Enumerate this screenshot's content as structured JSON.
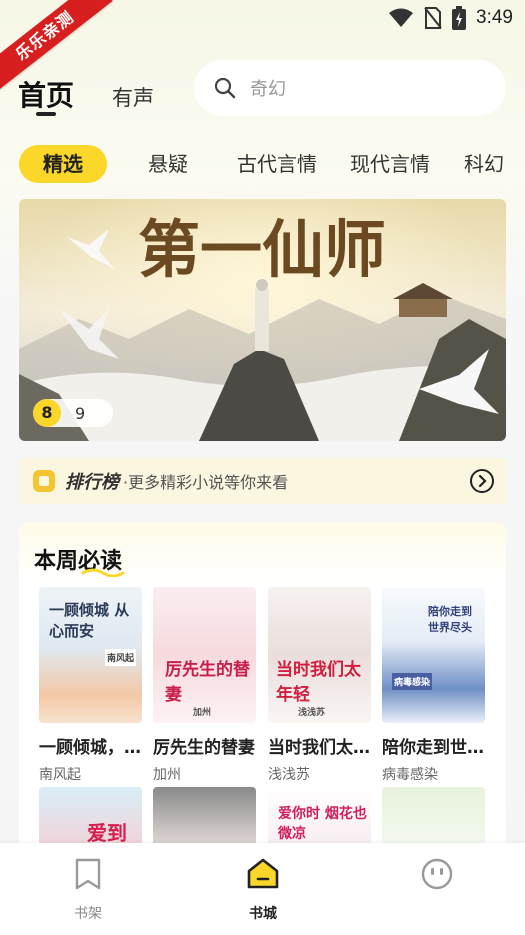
{
  "status_bar": {
    "time": "3:49"
  },
  "corner_ribbon": {
    "text": "乐乐亲测"
  },
  "header": {
    "tabs": [
      {
        "label": "首页",
        "active": true
      },
      {
        "label": "有声",
        "active": false
      }
    ],
    "search": {
      "placeholder": "奇幻"
    }
  },
  "category_tabs": [
    {
      "label": "精选",
      "active": true
    },
    {
      "label": "悬疑",
      "active": false
    },
    {
      "label": "古代言情",
      "active": false
    },
    {
      "label": "现代言情",
      "active": false
    },
    {
      "label": "科幻",
      "active": false
    }
  ],
  "banner": {
    "title": "第一仙师",
    "indicator": {
      "current": "8",
      "total": "9"
    }
  },
  "ranking": {
    "title": "排行榜",
    "subtitle": "·更多精彩小说等你来看"
  },
  "weekly": {
    "title": "本周必读",
    "books": [
      {
        "title": "一顾倾城，从心而安",
        "author": "南风起",
        "cover_text": "一顾倾城 从心而安",
        "cover_author": "南风起"
      },
      {
        "title": "厉先生的替妻",
        "author": "加州",
        "cover_text": "厉先生的替妻",
        "cover_author": "加州"
      },
      {
        "title": "当时我们太年轻",
        "author": "浅浅苏",
        "cover_text": "当时我们太年轻",
        "cover_author": "浅浅苏"
      },
      {
        "title": "陪你走到世界尽头",
        "author": "病毒感染",
        "cover_text": "陪你走到世界尽头",
        "cover_author": "病毒感染"
      }
    ],
    "second_row_cover_texts": [
      "爱到",
      "",
      "爱你时 烟花也微凉",
      ""
    ]
  },
  "bottom_nav": [
    {
      "label": "书架",
      "icon": "bookmark-icon",
      "active": false
    },
    {
      "label": "书城",
      "icon": "bookstore-icon",
      "active": true
    },
    {
      "label": "",
      "icon": "profile-face-icon",
      "active": false
    }
  ],
  "colors": {
    "accent": "#fbd72a",
    "ribbon": "#d81f1f"
  }
}
